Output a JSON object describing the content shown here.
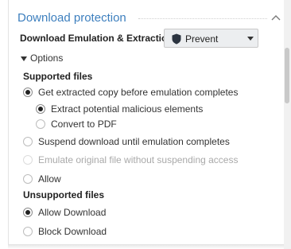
{
  "section": {
    "title": "Download protection"
  },
  "emulation": {
    "label": "Download Emulation & Extraction",
    "selected": "Prevent"
  },
  "options": {
    "label": "Options",
    "expanded": true
  },
  "supported": {
    "title": "Supported files",
    "items": [
      {
        "label": "Get extracted copy before emulation completes",
        "checked": true
      },
      {
        "label": "Extract potential malicious elements",
        "checked": true
      },
      {
        "label": "Convert to PDF",
        "checked": false
      },
      {
        "label": "Suspend download until emulation completes",
        "checked": false
      },
      {
        "label": "Emulate original file without suspending access",
        "checked": false,
        "disabled": true
      },
      {
        "label": "Allow",
        "checked": false
      }
    ]
  },
  "unsupported": {
    "title": "Unsupported files",
    "items": [
      {
        "label": "Allow Download",
        "checked": true
      },
      {
        "label": "Block Download",
        "checked": false
      }
    ]
  },
  "colors": {
    "accent": "#3d7fbe",
    "disabled_text": "#a9a9a9"
  },
  "icons": {
    "collapse": "chevron-up-icon",
    "select_icon": "shield-icon",
    "select_caret": "caret-down-icon",
    "options_toggle": "triangle-down-icon"
  }
}
